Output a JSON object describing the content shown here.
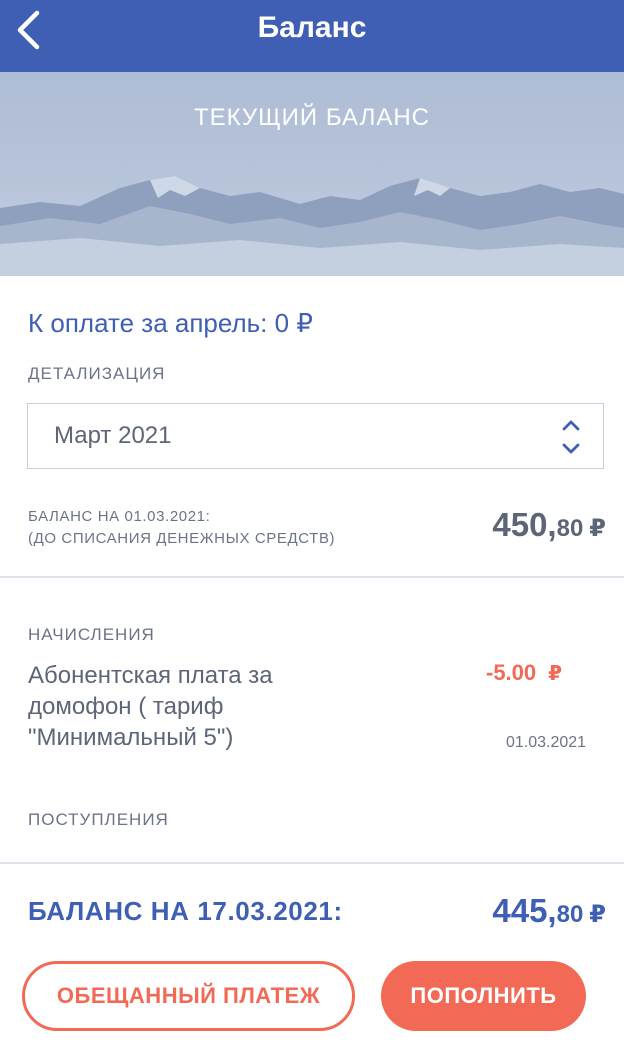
{
  "header": {
    "title": "Баланс",
    "back_icon": "chevron-left-icon"
  },
  "banner": {
    "title": "ТЕКУЩИЙ БАЛАНС"
  },
  "to_pay": {
    "text": "К оплате за апрель: 0 ₽"
  },
  "details": {
    "label": "ДЕТАЛИЗАЦИЯ",
    "selected_period": "Март 2021",
    "select_icon": "chevron-up-down-icon"
  },
  "balance_start": {
    "label_line1": "БАЛАНС НА 01.03.2021:",
    "label_line2": "(ДО СПИСАНИЯ ДЕНЕЖНЫХ СРЕДСТВ)",
    "amount_int": "450,",
    "amount_dec": "80",
    "currency": "₽"
  },
  "charges": {
    "label": "НАЧИСЛЕНИЯ",
    "items": [
      {
        "description": "Абонентская плата за домофон ( тариф \"Минимальный 5\")",
        "amount": "-5.00",
        "currency": "₽",
        "date": "01.03.2021"
      }
    ]
  },
  "payments": {
    "label": "ПОСТУПЛЕНИЯ"
  },
  "balance_end": {
    "label": "БАЛАНС НА 17.03.2021:",
    "amount_int": "445,",
    "amount_dec": "80",
    "currency": "₽"
  },
  "buttons": {
    "promise_label": "ОБЕЩАННЫЙ ПЛАТЕЖ",
    "topup_label": "ПОПОЛНИТЬ"
  },
  "colors": {
    "brand_blue": "#3f5fb4",
    "accent_coral": "#f26a55",
    "text_gray": "#5c6677"
  }
}
